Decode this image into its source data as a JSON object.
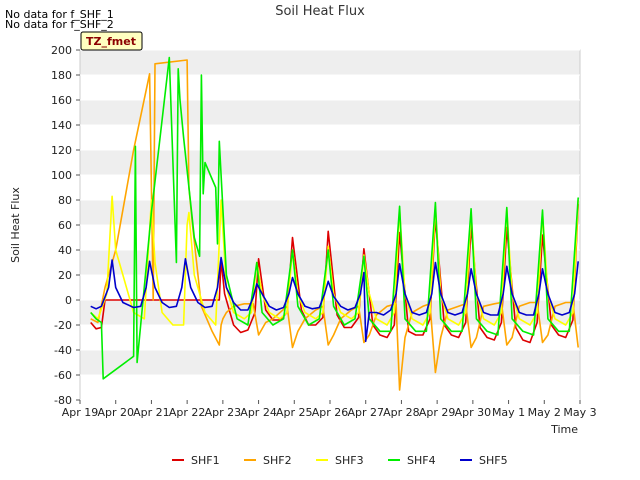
{
  "notes": [
    "No data for f_SHF_1",
    "No data for f_SHF_2"
  ],
  "colors": {
    "SHF1": "#dd0000",
    "SHF2": "#ffa500",
    "SHF3": "#ffff00",
    "SHF4": "#00ee00",
    "SHF5": "#0000cc",
    "band": "#eeeeee",
    "grid": "#ffffff",
    "badge_bg": "#ffffc0"
  },
  "chart_data": {
    "type": "line",
    "title": "Soil Heat Flux",
    "xlabel": "Time",
    "ylabel": "Soil Heat Flux",
    "badge": "TZ_fmet",
    "ylim": [
      -80,
      200
    ],
    "xlim": [
      0,
      14
    ],
    "yticks": [
      -80,
      -60,
      -40,
      -20,
      0,
      20,
      40,
      60,
      80,
      100,
      120,
      140,
      160,
      180,
      200
    ],
    "xtick_labels": [
      "Apr 19",
      "Apr 20",
      "Apr 21",
      "Apr 22",
      "Apr 23",
      "Apr 24",
      "Apr 25",
      "Apr 26",
      "Apr 27",
      "Apr 28",
      "Apr 29",
      "Apr 30",
      "May 1",
      "May 2",
      "May 3"
    ],
    "grid": true,
    "legend_position": "bottom",
    "series": [
      {
        "name": "SHF1",
        "x": [
          0.3,
          0.45,
          0.6,
          0.7,
          0.8,
          0.95,
          1.2,
          1.5,
          2.0,
          3.0,
          3.9,
          3.95,
          4.05,
          4.3,
          4.5,
          4.7,
          4.9,
          5.0,
          5.2,
          5.4,
          5.6,
          5.8,
          5.95,
          6.2,
          6.4,
          6.6,
          6.8,
          6.95,
          7.2,
          7.4,
          7.6,
          7.8,
          7.95,
          8.2,
          8.4,
          8.6,
          8.8,
          8.95,
          9.2,
          9.4,
          9.6,
          9.8,
          9.95,
          10.2,
          10.4,
          10.6,
          10.8,
          10.95,
          11.2,
          11.4,
          11.6,
          11.8,
          11.95,
          12.2,
          12.4,
          12.6,
          12.8,
          12.95,
          13.2,
          13.4,
          13.6,
          13.8,
          13.95
        ],
        "y": [
          -18,
          -23,
          -22,
          0,
          0,
          0,
          0,
          0,
          0,
          0,
          0,
          32,
          5,
          -20,
          -26,
          -24,
          -10,
          33,
          -8,
          -16,
          -16,
          -10,
          50,
          -8,
          -20,
          -20,
          -14,
          55,
          -12,
          -22,
          -22,
          -14,
          41,
          -20,
          -28,
          -30,
          -20,
          54,
          -25,
          -28,
          -28,
          -15,
          66,
          -20,
          -28,
          -30,
          -18,
          59,
          -22,
          -30,
          -32,
          -18,
          58,
          -22,
          -32,
          -34,
          -18,
          52,
          -20,
          -28,
          -30,
          -16,
          77
        ]
      },
      {
        "name": "SHF2",
        "x": [
          0.3,
          0.5,
          0.7,
          1.0,
          1.5,
          1.95,
          2.05,
          2.1,
          3.0,
          3.05,
          3.15,
          3.4,
          3.7,
          3.9,
          3.95,
          4.0,
          4.1,
          4.3,
          4.6,
          4.85,
          5.0,
          5.2,
          5.4,
          5.6,
          5.8,
          5.95,
          6.1,
          6.3,
          6.6,
          6.8,
          6.95,
          7.1,
          7.3,
          7.6,
          7.8,
          7.95,
          8.1,
          8.3,
          8.6,
          8.85,
          8.95,
          9.1,
          9.3,
          9.6,
          9.8,
          9.95,
          10.1,
          10.3,
          10.6,
          10.8,
          10.95,
          11.1,
          11.3,
          11.6,
          11.8,
          11.95,
          12.1,
          12.3,
          12.6,
          12.8,
          12.95,
          13.1,
          13.3,
          13.6,
          13.8,
          13.95
        ],
        "y": [
          -15,
          -18,
          10,
          40,
          120,
          181,
          0,
          189,
          192,
          90,
          60,
          -5,
          -25,
          -36,
          -20,
          -15,
          -10,
          -5,
          -3,
          -3,
          -28,
          -18,
          -15,
          -10,
          -5,
          -38,
          -25,
          -15,
          -8,
          -5,
          -36,
          -28,
          -15,
          -8,
          -5,
          -34,
          -28,
          -12,
          -5,
          -3,
          -72,
          -30,
          -10,
          -5,
          -3,
          -58,
          -30,
          -8,
          -5,
          -3,
          -38,
          -30,
          -5,
          -3,
          -2,
          -36,
          -30,
          -5,
          -2,
          -2,
          -34,
          -28,
          -5,
          -2,
          -2,
          -38
        ]
      },
      {
        "name": "SHF3",
        "x": [
          0.3,
          0.5,
          0.75,
          0.9,
          1.0,
          1.2,
          1.5,
          1.8,
          2.0,
          2.1,
          2.3,
          2.6,
          2.9,
          3.0,
          3.05,
          3.2,
          3.5,
          3.8,
          3.95,
          4.1,
          4.3,
          4.6,
          4.8,
          4.95,
          5.1,
          5.3,
          5.6,
          5.8,
          5.95,
          6.1,
          6.3,
          6.6,
          6.8,
          6.95,
          7.1,
          7.3,
          7.6,
          7.8,
          7.95,
          8.1,
          8.3,
          8.6,
          8.8,
          8.95,
          9.1,
          9.3,
          9.6,
          9.8,
          9.95,
          10.1,
          10.3,
          10.6,
          10.8,
          10.95,
          11.1,
          11.3,
          11.6,
          11.8,
          11.95,
          12.1,
          12.3,
          12.6,
          12.8,
          12.95,
          13.1,
          13.3,
          13.6,
          13.8,
          13.95
        ],
        "y": [
          -10,
          -15,
          5,
          83,
          40,
          20,
          -10,
          -15,
          80,
          30,
          -10,
          -20,
          -20,
          60,
          70,
          20,
          -10,
          -20,
          80,
          10,
          -10,
          -15,
          -10,
          30,
          5,
          -10,
          -15,
          -10,
          40,
          5,
          -10,
          -15,
          -10,
          43,
          5,
          -10,
          -15,
          -10,
          36,
          5,
          -15,
          -20,
          -10,
          72,
          5,
          -15,
          -20,
          -10,
          75,
          5,
          -15,
          -20,
          -10,
          70,
          5,
          -15,
          -20,
          -10,
          73,
          5,
          -15,
          -20,
          -10,
          70,
          5,
          -15,
          -20,
          -10,
          80
        ]
      },
      {
        "name": "SHF4",
        "x": [
          0.3,
          0.45,
          0.6,
          0.65,
          1.5,
          1.55,
          1.6,
          2.0,
          2.5,
          2.7,
          2.75,
          2.8,
          2.9,
          3.2,
          3.35,
          3.4,
          3.45,
          3.5,
          3.8,
          3.85,
          3.9,
          4.1,
          4.4,
          4.7,
          4.95,
          5.1,
          5.4,
          5.7,
          5.95,
          6.1,
          6.4,
          6.7,
          6.95,
          7.1,
          7.4,
          7.7,
          7.95,
          8.1,
          8.4,
          8.7,
          8.95,
          9.1,
          9.4,
          9.7,
          9.95,
          10.1,
          10.4,
          10.7,
          10.95,
          11.1,
          11.4,
          11.7,
          11.95,
          12.1,
          12.4,
          12.7,
          12.95,
          13.1,
          13.4,
          13.7,
          13.95
        ],
        "y": [
          -10,
          -15,
          -18,
          -63,
          -45,
          123,
          -50,
          70,
          194,
          30,
          185,
          160,
          130,
          50,
          35,
          180,
          85,
          110,
          90,
          45,
          127,
          20,
          -15,
          -20,
          30,
          -10,
          -20,
          -15,
          40,
          -5,
          -20,
          -15,
          40,
          -5,
          -20,
          -15,
          35,
          -15,
          -25,
          -25,
          75,
          -15,
          -25,
          -25,
          78,
          -15,
          -25,
          -25,
          73,
          -15,
          -25,
          -28,
          74,
          -15,
          -25,
          -28,
          72,
          -15,
          -25,
          -25,
          82
        ]
      },
      {
        "name": "SHF5",
        "x": [
          0.3,
          0.45,
          0.6,
          0.8,
          0.9,
          1.0,
          1.2,
          1.5,
          1.7,
          1.85,
          1.95,
          2.1,
          2.3,
          2.5,
          2.7,
          2.85,
          2.95,
          3.1,
          3.3,
          3.5,
          3.7,
          3.85,
          3.95,
          4.1,
          4.3,
          4.5,
          4.7,
          4.85,
          4.95,
          5.1,
          5.3,
          5.5,
          5.7,
          5.85,
          5.95,
          6.1,
          6.3,
          6.5,
          6.7,
          6.85,
          6.95,
          7.1,
          7.3,
          7.5,
          7.7,
          7.85,
          7.95,
          8.0,
          8.1,
          8.3,
          8.5,
          8.7,
          8.85,
          8.95,
          9.1,
          9.3,
          9.5,
          9.7,
          9.85,
          9.95,
          10.1,
          10.3,
          10.5,
          10.7,
          10.85,
          10.95,
          11.1,
          11.3,
          11.5,
          11.7,
          11.85,
          11.95,
          12.1,
          12.3,
          12.5,
          12.7,
          12.85,
          12.95,
          13.1,
          13.3,
          13.5,
          13.7,
          13.85,
          13.95
        ],
        "y": [
          -5,
          -7,
          -5,
          10,
          32,
          10,
          -2,
          -6,
          -5,
          10,
          31,
          10,
          -2,
          -6,
          -5,
          10,
          33,
          10,
          -2,
          -6,
          -5,
          10,
          34,
          10,
          -2,
          -8,
          -8,
          2,
          13,
          5,
          -5,
          -8,
          -6,
          5,
          18,
          5,
          -5,
          -7,
          -6,
          5,
          15,
          3,
          -5,
          -8,
          -6,
          5,
          22,
          -33,
          -10,
          -10,
          -12,
          -8,
          5,
          29,
          5,
          -10,
          -12,
          -10,
          5,
          30,
          5,
          -10,
          -12,
          -10,
          5,
          25,
          5,
          -10,
          -12,
          -12,
          5,
          27,
          5,
          -10,
          -12,
          -12,
          5,
          25,
          5,
          -10,
          -12,
          -10,
          5,
          31
        ]
      }
    ]
  }
}
